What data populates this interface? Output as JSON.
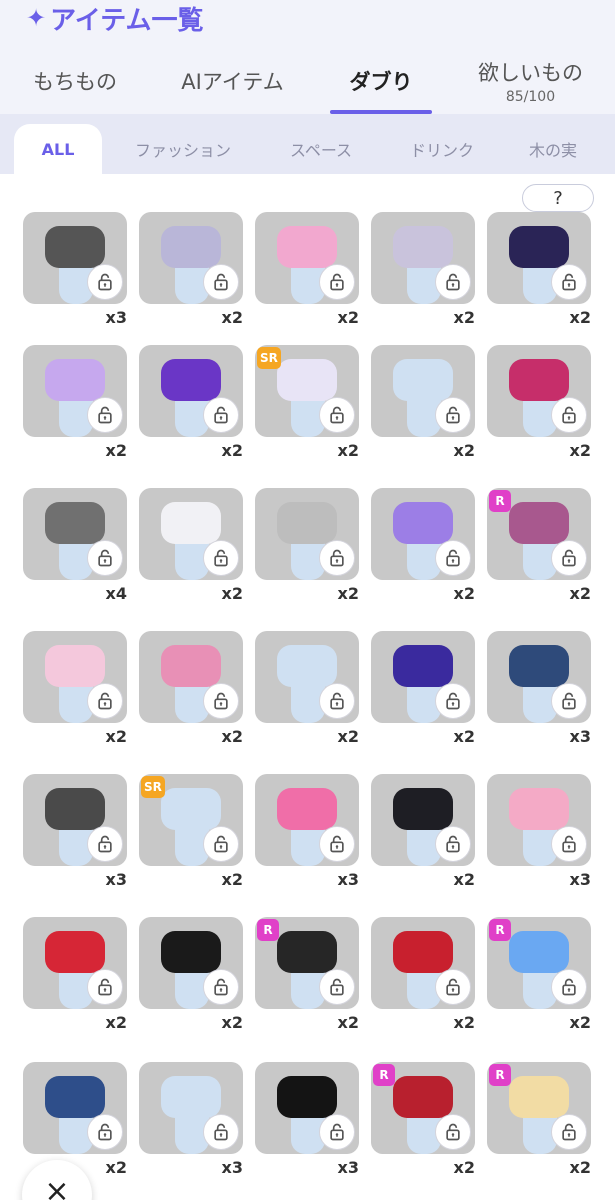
{
  "header": {
    "title": "アイテム一覧"
  },
  "tabs": [
    {
      "label": "もちもの",
      "active": false
    },
    {
      "label": "AIアイテム",
      "active": false
    },
    {
      "label": "ダブり",
      "active": true
    },
    {
      "label": "欲しいもの",
      "sub": "85/100",
      "active": false
    }
  ],
  "filters": [
    {
      "label": "ALL",
      "active": true
    },
    {
      "label": "ファッション",
      "active": false
    },
    {
      "label": "スペース",
      "active": false
    },
    {
      "label": "ドリンク",
      "active": false
    },
    {
      "label": "木の実",
      "active": false
    }
  ],
  "help_label": "?",
  "close_label": "×",
  "colors": {
    "accent": "#6a5fe8",
    "badge_r": "#e040c8",
    "badge_sr": "#f5a623"
  },
  "items": [
    {
      "count": "x3",
      "badge": "",
      "color": "#555555"
    },
    {
      "count": "x2",
      "badge": "",
      "color": "#b9b6d8"
    },
    {
      "count": "x2",
      "badge": "",
      "color": "#f2a8cf"
    },
    {
      "count": "x2",
      "badge": "",
      "color": "#c9c3dc"
    },
    {
      "count": "x2",
      "badge": "",
      "color": "#2a2456"
    },
    {
      "count": "x2",
      "badge": "",
      "color": "#c6a8ee"
    },
    {
      "count": "x2",
      "badge": "",
      "color": "#6a36c6"
    },
    {
      "count": "x2",
      "badge": "SR",
      "color": "#e8e4f6"
    },
    {
      "count": "x2",
      "badge": "",
      "color": "#cfe0f2"
    },
    {
      "count": "x2",
      "badge": "",
      "color": "#c62e6a"
    },
    {
      "count": "x4",
      "badge": "",
      "color": "#707070"
    },
    {
      "count": "x2",
      "badge": "",
      "color": "#f1f1f5"
    },
    {
      "count": "x2",
      "badge": "",
      "color": "#bdbdbd"
    },
    {
      "count": "x2",
      "badge": "",
      "color": "#9c7ee6"
    },
    {
      "count": "x2",
      "badge": "R",
      "color": "#a8588e"
    },
    {
      "count": "x2",
      "badge": "",
      "color": "#f4c8dc"
    },
    {
      "count": "x2",
      "badge": "",
      "color": "#e890b6"
    },
    {
      "count": "x2",
      "badge": "",
      "color": "#cfe0f2"
    },
    {
      "count": "x2",
      "badge": "",
      "color": "#3a2a9e"
    },
    {
      "count": "x3",
      "badge": "",
      "color": "#2e4a7a"
    },
    {
      "count": "x3",
      "badge": "",
      "color": "#4a4a4a"
    },
    {
      "count": "x2",
      "badge": "SR",
      "color": "#cfe0f2"
    },
    {
      "count": "x3",
      "badge": "",
      "color": "#f06ea8"
    },
    {
      "count": "x2",
      "badge": "",
      "color": "#1e1e24"
    },
    {
      "count": "x3",
      "badge": "",
      "color": "#f4aac6"
    },
    {
      "count": "x2",
      "badge": "",
      "color": "#d62636"
    },
    {
      "count": "x2",
      "badge": "",
      "color": "#1a1a1a"
    },
    {
      "count": "x2",
      "badge": "R",
      "color": "#262626"
    },
    {
      "count": "x2",
      "badge": "",
      "color": "#c8202e"
    },
    {
      "count": "x2",
      "badge": "R",
      "color": "#6aa8f2"
    },
    {
      "count": "x2",
      "badge": "",
      "color": "#2e4e8a"
    },
    {
      "count": "x3",
      "badge": "",
      "color": "#cfe0f2"
    },
    {
      "count": "x3",
      "badge": "",
      "color": "#141414"
    },
    {
      "count": "x2",
      "badge": "R",
      "color": "#b8202e"
    },
    {
      "count": "x2",
      "badge": "R",
      "color": "#f2dca4"
    }
  ]
}
